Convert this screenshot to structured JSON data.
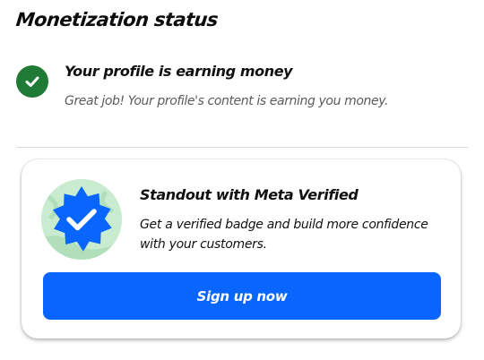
{
  "page": {
    "title": "Monetization status"
  },
  "status": {
    "heading": "Your profile is earning money",
    "subtext": "Great job! Your profile's content is earning you money.",
    "icon": "check-circle-icon",
    "color": "#1f7a36"
  },
  "promo": {
    "heading": "Standout with Meta Verified",
    "body": "Get a verified badge and build more confidence with your customers.",
    "badge_icon": "verified-badge-icon",
    "badge_color": "#0866ff",
    "badge_bg_color": "#c9ecd0",
    "button_label": "Sign up now",
    "button_color": "#0866ff"
  }
}
